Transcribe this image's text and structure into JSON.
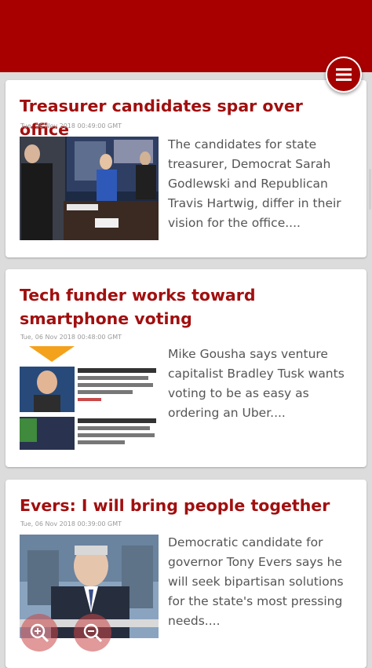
{
  "articles": [
    {
      "title": "Treasurer candidates spar over office",
      "date": "Tue, 06 Nov 2018 00:49:00 GMT",
      "summary": "The candidates for state treasurer, Democrat Sarah Godlewski and Republican Travis Hartwig, differ in their vision for the office...."
    },
    {
      "title": "Tech funder works toward smartphone voting",
      "date": "Tue, 06 Nov 2018 00:48:00 GMT",
      "summary": "Mike Gousha says venture capitalist Bradley Tusk wants voting to be as easy as ordering an Uber...."
    },
    {
      "title": "Evers: I will bring people together",
      "date": "Tue, 06 Nov 2018 00:39:00 GMT",
      "summary": "Democratic candidate for governor Tony Evers says he will seek bipartisan solutions for the state's most pressing needs...."
    }
  ],
  "icons": {
    "menu": "menu-icon",
    "zoom_in": "zoom-in-icon",
    "zoom_out": "zoom-out-icon"
  },
  "colors": {
    "brand": "#a80000",
    "title": "#a10f0f",
    "summary": "#555555",
    "background": "#dcdcdc"
  }
}
